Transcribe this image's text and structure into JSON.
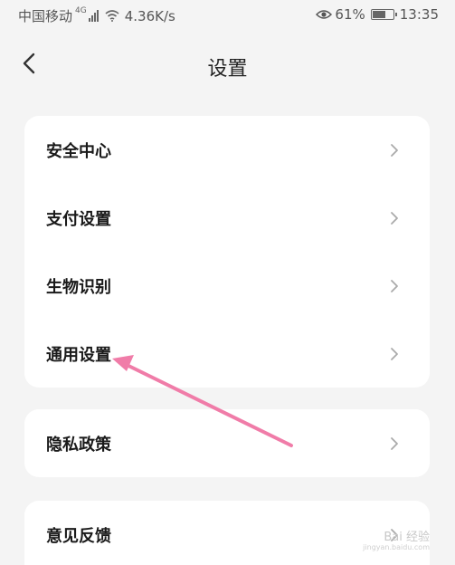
{
  "status_bar": {
    "carrier": "中国移动",
    "network_badge": "4G",
    "speed": "4.36K/s",
    "battery_percent": "61%",
    "time": "13:35",
    "icons": [
      "signal-icon",
      "wifi-icon",
      "eye-icon",
      "battery-icon"
    ]
  },
  "header": {
    "title": "设置",
    "back_icon": "chevron-left-icon"
  },
  "groups": [
    {
      "items": [
        {
          "label": "安全中心"
        },
        {
          "label": "支付设置"
        },
        {
          "label": "生物识别"
        },
        {
          "label": "通用设置"
        }
      ]
    },
    {
      "items": [
        {
          "label": "隐私政策"
        }
      ]
    },
    {
      "items": [
        {
          "label": "意见反馈"
        }
      ]
    }
  ],
  "annotation": {
    "arrow_color": "#f07ca8"
  },
  "watermark": {
    "text": "Bai 经验",
    "sub": "jingyan.baidu.com"
  }
}
